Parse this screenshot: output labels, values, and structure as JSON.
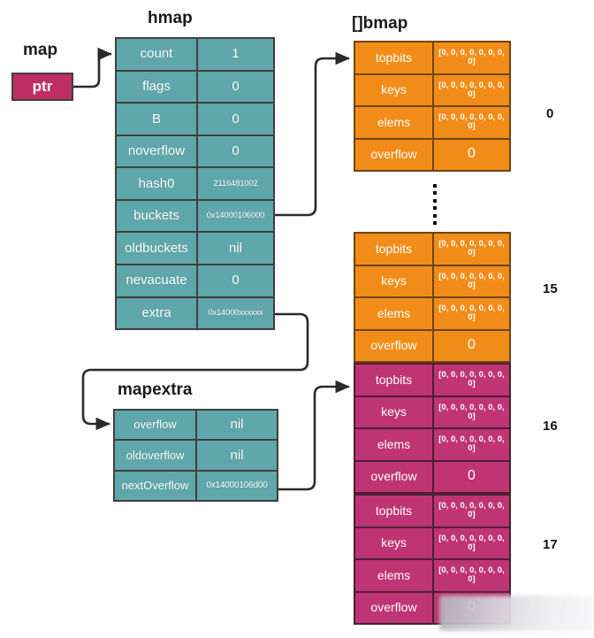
{
  "captions": {
    "map": "map",
    "hmap": "hmap",
    "bmap": "[]bmap",
    "mapextra": "mapextra"
  },
  "map_ptr": {
    "label": "ptr",
    "color": "#bf2e63"
  },
  "hmap": {
    "color": "#5fa7ab",
    "rows": [
      {
        "name": "count",
        "value": "1"
      },
      {
        "name": "flags",
        "value": "0"
      },
      {
        "name": "B",
        "value": "0"
      },
      {
        "name": "noverflow",
        "value": "0"
      },
      {
        "name": "hash0",
        "value": "2116481002"
      },
      {
        "name": "buckets",
        "value": "0x14000106000"
      },
      {
        "name": "oldbuckets",
        "value": "nil"
      },
      {
        "name": "nevacuate",
        "value": "0"
      },
      {
        "name": "extra",
        "value": "0x14000xxxxxx"
      }
    ]
  },
  "mapextra": {
    "color": "#5fa7ab",
    "rows": [
      {
        "name": "overflow",
        "value": "nil"
      },
      {
        "name": "oldoverflow",
        "value": "nil"
      },
      {
        "name": "nextOverflow",
        "value": "0x14000106d00"
      }
    ]
  },
  "bmap_array": {
    "orange": "#f28c18",
    "magenta": "#bf3472",
    "array_value": "[0, 0, 0, 0, 0, 0, 0, 0]",
    "overflow_value": "0",
    "buckets": [
      {
        "index": "0",
        "color": "orange",
        "rows": [
          {
            "name": "topbits",
            "value": "[0, 0, 0, 0, 0, 0, 0, 0]"
          },
          {
            "name": "keys",
            "value": "[0, 0, 0, 0, 0, 0, 0, 0]"
          },
          {
            "name": "elems",
            "value": "[0, 0, 0, 0, 0, 0, 0, 0]"
          },
          {
            "name": "overflow",
            "value": "0"
          }
        ]
      },
      {
        "index": "15",
        "color": "orange",
        "rows": [
          {
            "name": "topbits",
            "value": "[0, 0, 0, 0, 0, 0, 0, 0]"
          },
          {
            "name": "keys",
            "value": "[0, 0, 0, 0, 0, 0, 0, 0]"
          },
          {
            "name": "elems",
            "value": "[0, 0, 0, 0, 0, 0, 0, 0]"
          },
          {
            "name": "overflow",
            "value": "0"
          }
        ]
      },
      {
        "index": "16",
        "color": "magenta",
        "rows": [
          {
            "name": "topbits",
            "value": "[0, 0, 0, 0, 0, 0, 0, 0]"
          },
          {
            "name": "keys",
            "value": "[0, 0, 0, 0, 0, 0, 0, 0]"
          },
          {
            "name": "elems",
            "value": "[0, 0, 0, 0, 0, 0, 0, 0]"
          },
          {
            "name": "overflow",
            "value": "0"
          }
        ]
      },
      {
        "index": "17",
        "color": "magenta",
        "rows": [
          {
            "name": "topbits",
            "value": "[0, 0, 0, 0, 0, 0, 0, 0]"
          },
          {
            "name": "keys",
            "value": "[0, 0, 0, 0, 0, 0, 0, 0]"
          },
          {
            "name": "elems",
            "value": "[0, 0, 0, 0, 0, 0, 0, 0]"
          },
          {
            "name": "overflow",
            "value": "0"
          }
        ]
      }
    ]
  }
}
